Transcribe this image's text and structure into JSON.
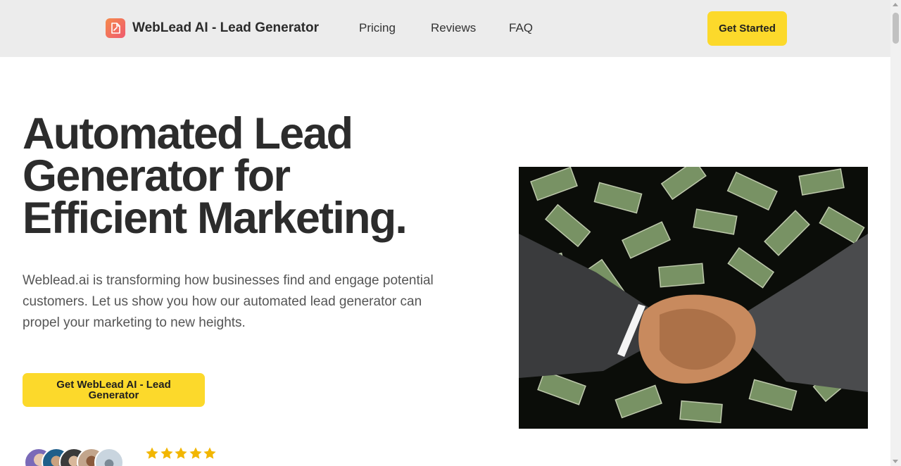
{
  "brand": {
    "name": "WebLead AI - Lead Generator",
    "logo_icon": "document-icon",
    "logo_color": "#f26f5c"
  },
  "nav": {
    "links": [
      "Pricing",
      "Reviews",
      "FAQ"
    ],
    "cta_label": "Get Started"
  },
  "hero": {
    "title_lines": [
      "Automated Lead",
      "Generator for",
      "Efficient Marketing."
    ],
    "description": "Weblead.ai is transforming how businesses find and engage potential customers. Let us show you how our automated lead generator can propel your marketing to new heights.",
    "cta_label": "Get WebLead AI - Lead Generator",
    "image_icon": "handshake-money-image"
  },
  "social_proof": {
    "avatar_count": 5,
    "rating": 5,
    "max_rating": 5
  },
  "colors": {
    "accent": "#fcd92b",
    "nav_bg": "#ececec",
    "star": "#f2b600",
    "text": "#2c2c2c"
  }
}
